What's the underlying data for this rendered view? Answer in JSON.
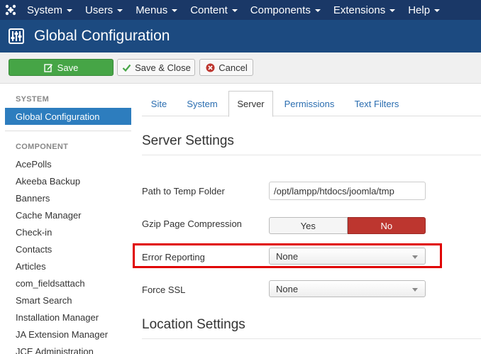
{
  "topbar": {
    "menus": [
      {
        "label": "System"
      },
      {
        "label": "Users"
      },
      {
        "label": "Menus"
      },
      {
        "label": "Content"
      },
      {
        "label": "Components"
      },
      {
        "label": "Extensions"
      },
      {
        "label": "Help"
      }
    ]
  },
  "header": {
    "title": "Global Configuration"
  },
  "toolbar": {
    "save_label": "Save",
    "save_close_label": "Save & Close",
    "cancel_label": "Cancel"
  },
  "sidebar": {
    "system_header": "SYSTEM",
    "active_item": "Global Configuration",
    "component_header": "COMPONENT",
    "items": [
      "AcePolls",
      "Akeeba Backup",
      "Banners",
      "Cache Manager",
      "Check-in",
      "Contacts",
      "Articles",
      "com_fieldsattach",
      "Smart Search",
      "Installation Manager",
      "JA Extension Manager",
      "JCE Administration"
    ]
  },
  "tabs": [
    {
      "label": "Site"
    },
    {
      "label": "System"
    },
    {
      "label": "Server",
      "active": true
    },
    {
      "label": "Permissions"
    },
    {
      "label": "Text Filters"
    }
  ],
  "server_settings": {
    "title": "Server Settings",
    "temp_folder_label": "Path to Temp Folder",
    "temp_folder_value": "/opt/lampp/htdocs/joomla/tmp",
    "gzip_label": "Gzip Page Compression",
    "gzip_yes": "Yes",
    "gzip_no": "No",
    "error_reporting_label": "Error Reporting",
    "error_reporting_value": "None",
    "force_ssl_label": "Force SSL",
    "force_ssl_value": "None"
  },
  "location_settings": {
    "title": "Location Settings"
  },
  "colors": {
    "topbar": "#1a3867",
    "titlebar": "#1c4a80",
    "save_green": "#46a546",
    "active_blue": "#2d7dbe",
    "no_red": "#bd362f",
    "highlight_red": "#e00000"
  }
}
